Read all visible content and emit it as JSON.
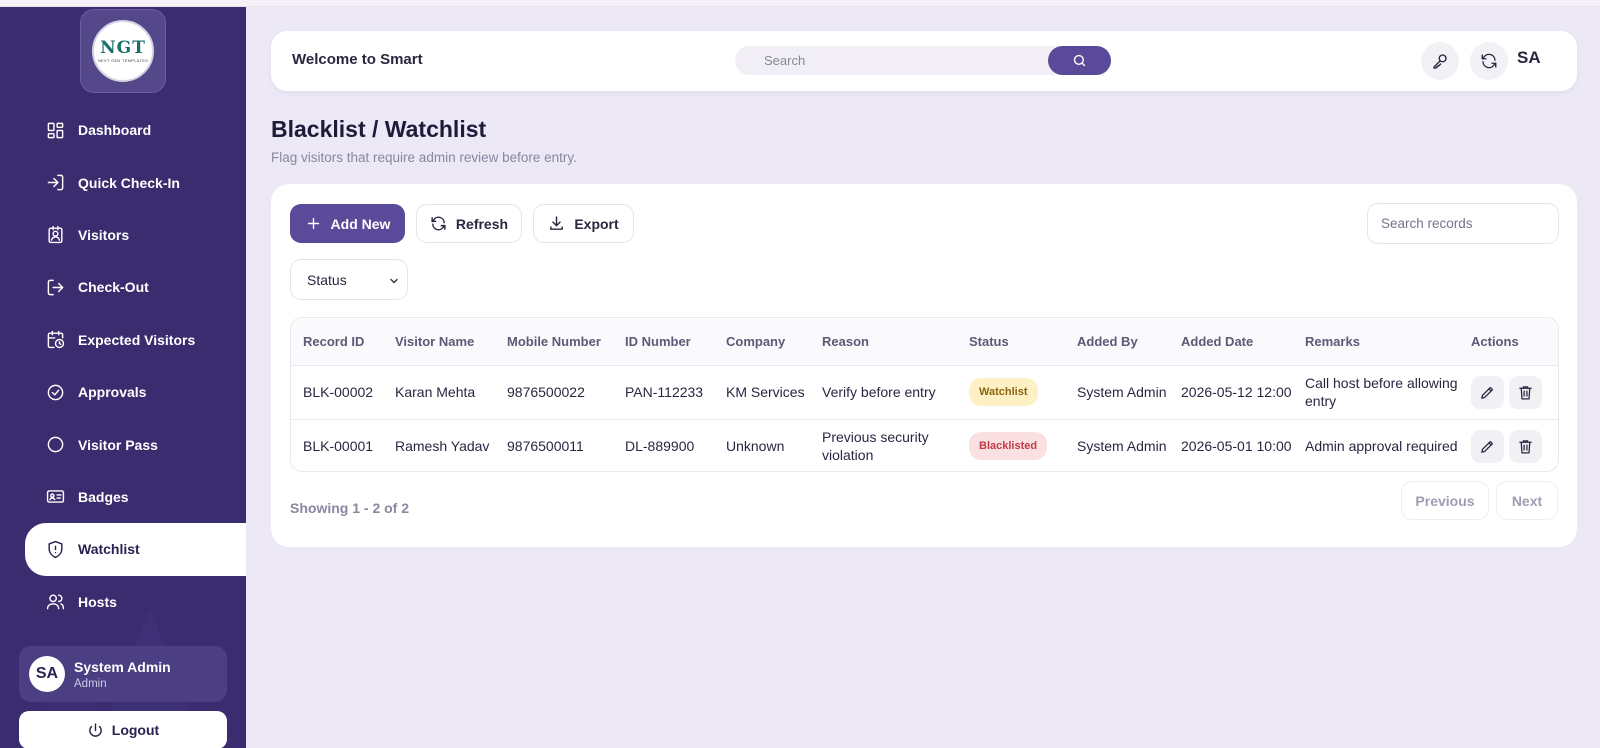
{
  "brand": {
    "logo_text": "NGT",
    "logo_subtext": "NEXT GEN TEMPLATES"
  },
  "sidebar": {
    "items": [
      {
        "label": "Dashboard",
        "icon": "dashboard-icon"
      },
      {
        "label": "Quick Check-In",
        "icon": "login-icon"
      },
      {
        "label": "Visitors",
        "icon": "visitor-badge-icon"
      },
      {
        "label": "Check-Out",
        "icon": "logout-arrow-icon"
      },
      {
        "label": "Expected Visitors",
        "icon": "calendar-clock-icon"
      },
      {
        "label": "Approvals",
        "icon": "check-circle-icon"
      },
      {
        "label": "Visitor Pass",
        "icon": "circle-icon"
      },
      {
        "label": "Badges",
        "icon": "id-card-icon"
      },
      {
        "label": "Watchlist",
        "icon": "shield-alert-icon",
        "active": true
      },
      {
        "label": "Hosts",
        "icon": "users-icon"
      }
    ],
    "user": {
      "initials": "SA",
      "name": "System Admin",
      "role": "Admin"
    },
    "logout_label": "Logout"
  },
  "header": {
    "welcome": "Welcome to Smart",
    "search_placeholder": "Search",
    "avatar_initials": "SA"
  },
  "page": {
    "title": "Blacklist / Watchlist",
    "subtitle": "Flag visitors that require admin review before entry."
  },
  "toolbar": {
    "add_label": "Add New",
    "refresh_label": "Refresh",
    "export_label": "Export",
    "search_placeholder": "Search records",
    "status_filter": "Status"
  },
  "table": {
    "columns": [
      "Record ID",
      "Visitor Name",
      "Mobile Number",
      "ID Number",
      "Company",
      "Reason",
      "Status",
      "Added By",
      "Added Date",
      "Remarks",
      "Actions"
    ],
    "rows": [
      {
        "record_id": "BLK-00002",
        "visitor_name": "Karan Mehta",
        "mobile": "9876500022",
        "id_number": "PAN-112233",
        "company": "KM Services",
        "reason": "Verify before entry",
        "status": "Watchlist",
        "added_by": "System Admin",
        "added_date": "2026-05-12 12:00",
        "remarks": "Call host before allowing entry"
      },
      {
        "record_id": "BLK-00001",
        "visitor_name": "Ramesh Yadav",
        "mobile": "9876500011",
        "id_number": "DL-889900",
        "company": "Unknown",
        "reason": "Previous security violation",
        "status": "Blacklisted",
        "added_by": "System Admin",
        "added_date": "2026-05-01 10:00",
        "remarks": "Admin approval required"
      }
    ]
  },
  "pagination": {
    "showing": "Showing 1 - 2 of 2",
    "previous": "Previous",
    "next": "Next"
  },
  "colors": {
    "sidebar": "#3a2c6e",
    "accent": "#5a4a99",
    "watchlist_badge": "#fdf0c4",
    "blacklisted_badge": "#fbe0e1"
  }
}
